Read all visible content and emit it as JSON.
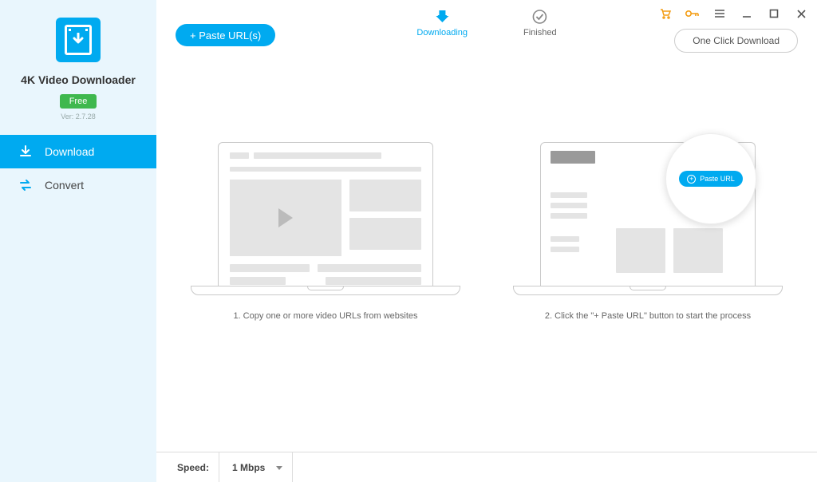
{
  "app": {
    "title": "4K Video Downloader",
    "badge": "Free",
    "version": "Ver: 2.7.28"
  },
  "nav": {
    "download": "Download",
    "convert": "Convert"
  },
  "toolbar": {
    "paste_url": "+ Paste URL(s)",
    "one_click": "One Click Download"
  },
  "tabs": {
    "downloading": "Downloading",
    "finished": "Finished"
  },
  "steps": {
    "s1_caption": "1. Copy one or more video URLs from websites",
    "s2_caption": "2. Click the \"+ Paste URL\" button to start the process",
    "mini_paste": "Paste URL"
  },
  "footer": {
    "speed_label": "Speed:",
    "speed_value": "1 Mbps"
  },
  "colors": {
    "accent": "#00aaf0",
    "sidebar_bg": "#e9f6fd",
    "badge_green": "#3fb84e",
    "warn": "#f39c12"
  }
}
